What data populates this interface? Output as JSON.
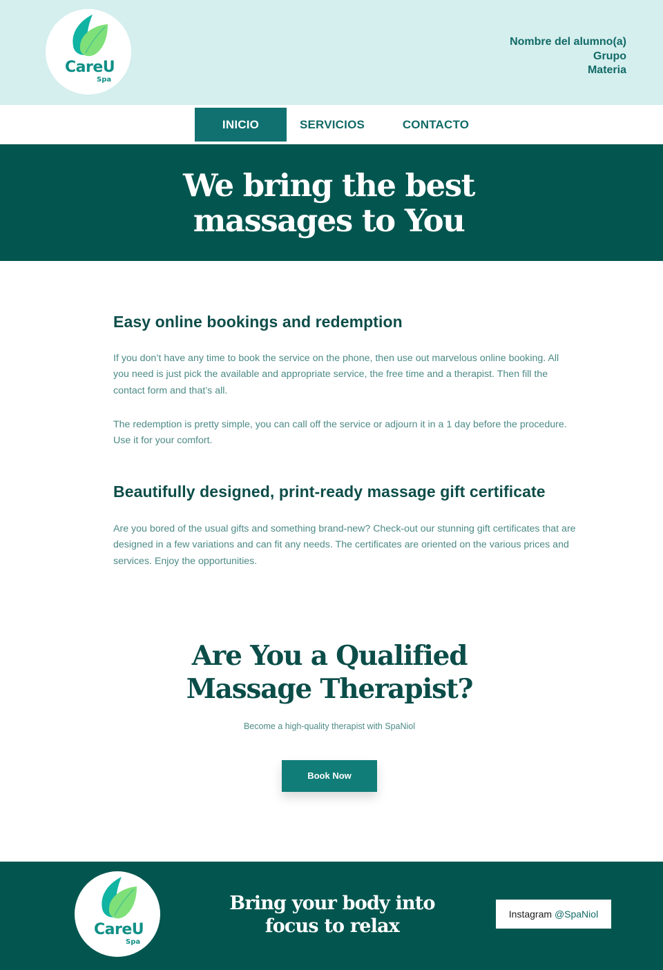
{
  "brand": {
    "name": "CareU",
    "sub": "Spa"
  },
  "header": {
    "student_name": "Nombre del alumno(a)",
    "group": "Grupo",
    "subject": "Materia"
  },
  "nav": {
    "items": [
      {
        "label": "INICIO",
        "active": true
      },
      {
        "label": "SERVICIOS",
        "active": false
      },
      {
        "label": "CONTACTO",
        "active": false
      }
    ]
  },
  "hero": {
    "line1": "We bring the best",
    "line2": "massages to You"
  },
  "sections": [
    {
      "heading": "Easy online bookings and redemption",
      "paragraphs": [
        "If you don’t have any time to book the service on the phone, then use out marvelous online booking. All you need is just pick the available and appropriate service, the free time and a therapist. Then fill the contact form and that’s all.",
        "The redemption is pretty simple, you can call off the service or adjourn it in a 1 day before the procedure. Use it for your comfort."
      ]
    },
    {
      "heading": "Beautifully designed, print-ready massage gift certificate",
      "paragraphs": [
        "Are you bored of the usual gifts and something brand-new? Check-out our stunning gift certificates that are designed in a few variations and can fit any needs. The certificates are oriented on the various prices and services. Enjoy the opportunities."
      ]
    }
  ],
  "cta": {
    "line1": "Are You a Qualified",
    "line2": "Massage Therapist?",
    "subtitle": "Become a high-quality therapist with SpaNiol",
    "button": "Book Now"
  },
  "footer": {
    "line1": "Bring your body into",
    "line2": "focus to relax",
    "instagram_label": "Instagram",
    "instagram_handle": "@SpaNiol"
  },
  "colors": {
    "header_bg": "#d5eeee",
    "primary_dark": "#03564f",
    "nav_active": "#117170",
    "button": "#117d78",
    "logo_teal": "#0f8f86",
    "leaf_light": "#7fe07a",
    "leaf_dark": "#11b3a2"
  }
}
